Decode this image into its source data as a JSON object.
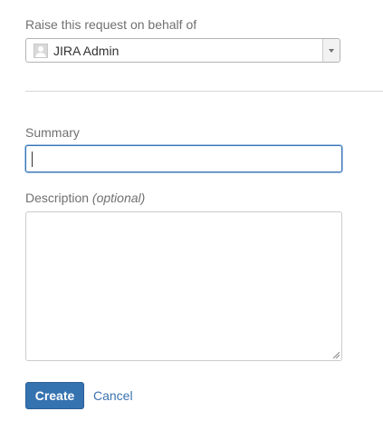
{
  "on_behalf": {
    "label": "Raise this request on behalf of",
    "selected_user": "JIRA Admin"
  },
  "summary": {
    "label": "Summary",
    "value": ""
  },
  "description": {
    "label": "Description",
    "optional_hint": "(optional)",
    "value": ""
  },
  "actions": {
    "create_label": "Create",
    "cancel_label": "Cancel"
  },
  "colors": {
    "primary_button": "#3572b0",
    "link": "#3b73af",
    "focus_border": "#3b73af"
  }
}
